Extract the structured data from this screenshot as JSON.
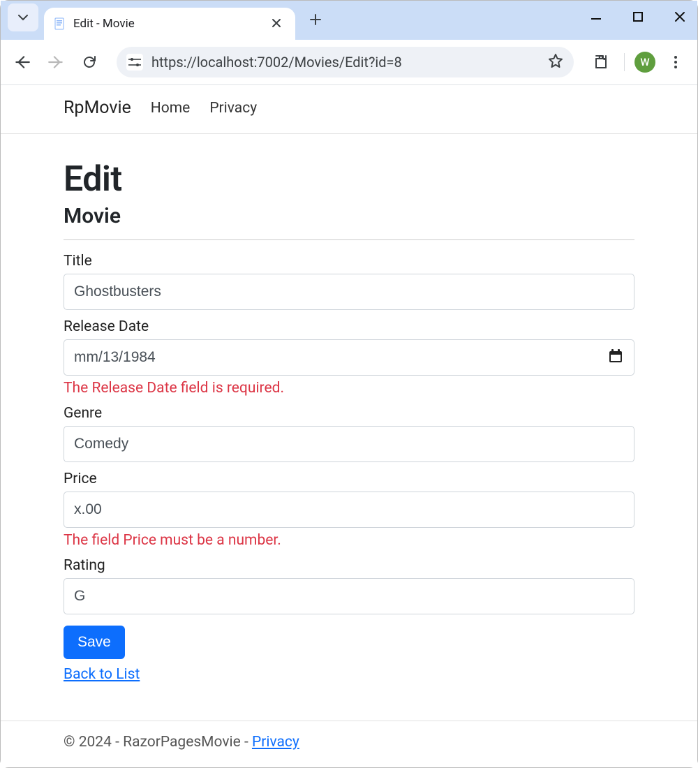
{
  "browser": {
    "tab_title": "Edit - Movie",
    "url": "https://localhost:7002/Movies/Edit?id=8",
    "avatar_initial": "W"
  },
  "navbar": {
    "brand": "RpMovie",
    "links": [
      "Home",
      "Privacy"
    ]
  },
  "page": {
    "heading": "Edit",
    "subheading": "Movie"
  },
  "form": {
    "title": {
      "label": "Title",
      "value": "Ghostbusters"
    },
    "release_date": {
      "label": "Release Date",
      "value": "mm/13/1984",
      "error": "The Release Date field is required."
    },
    "genre": {
      "label": "Genre",
      "value": "Comedy"
    },
    "price": {
      "label": "Price",
      "value": "x.00",
      "error": "The field Price must be a number."
    },
    "rating": {
      "label": "Rating",
      "value": "G"
    },
    "submit": "Save",
    "back": "Back to List"
  },
  "footer": {
    "text": "© 2024 - RazorPagesMovie - ",
    "link": "Privacy"
  }
}
